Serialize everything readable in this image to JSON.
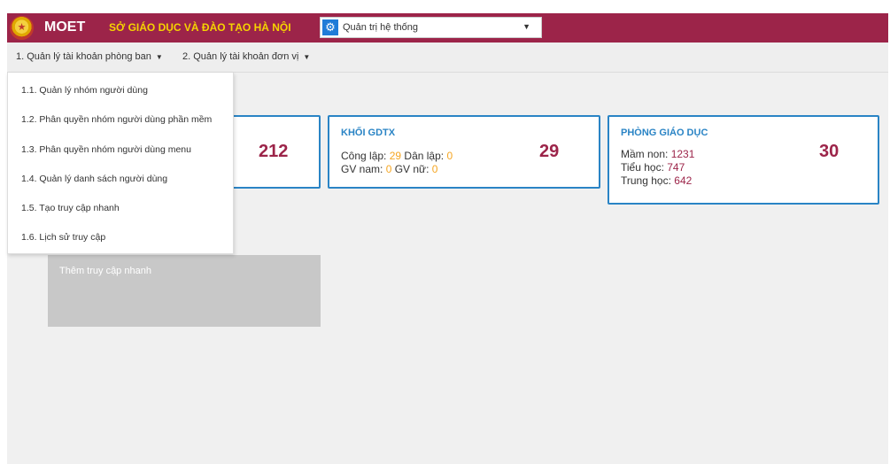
{
  "header": {
    "brand": "MOET",
    "org_name": "SỞ GIÁO DỤC VÀ ĐÀO TẠO HÀ NỘI",
    "role_select": {
      "value": "Quản trị hệ thống",
      "icon": "gear-icon"
    },
    "logo_icon": "national-emblem-icon",
    "accent_color": "#9c2449"
  },
  "menubar": {
    "items": [
      {
        "label": "1. Quản lý tài khoản phòng ban"
      },
      {
        "label": "2. Quản lý tài khoản đơn vị"
      }
    ]
  },
  "dropdown": {
    "items": [
      {
        "label": "1.1. Quản lý nhóm người dùng"
      },
      {
        "label": "1.2. Phân quyền nhóm người dùng phần mềm"
      },
      {
        "label": "1.3. Phân quyền nhóm người dùng menu"
      },
      {
        "label": "1.4. Quản lý danh sách người dùng"
      },
      {
        "label": "1.5. Tạo truy cập nhanh"
      },
      {
        "label": "1.6. Lịch sử truy cập"
      }
    ]
  },
  "cards": {
    "first": {
      "count": "212"
    },
    "gdtx": {
      "title": "KHỐI GDTX",
      "count": "29",
      "cong_lap_label": "Công lập: ",
      "cong_lap_value": "29",
      "dan_lap_label": " Dân lập: ",
      "dan_lap_value": "0",
      "gv_nam_label": "GV nam: ",
      "gv_nam_value": "0",
      "gv_nu_label": " GV nữ: ",
      "gv_nu_value": "0"
    },
    "pgd": {
      "title": "PHÒNG GIÁO DỤC",
      "count": "30",
      "mam_non_label": "Mầm non: ",
      "mam_non_value": "1231",
      "tieu_hoc_label": "Tiểu học: ",
      "tieu_hoc_value": "747",
      "trung_hoc_label": "Trung học: ",
      "trung_hoc_value": "642"
    }
  },
  "quick_access": {
    "add_label": "Thêm truy cập nhanh"
  },
  "colors": {
    "card_border": "#2a84c5",
    "highlight": "#f5a623"
  }
}
